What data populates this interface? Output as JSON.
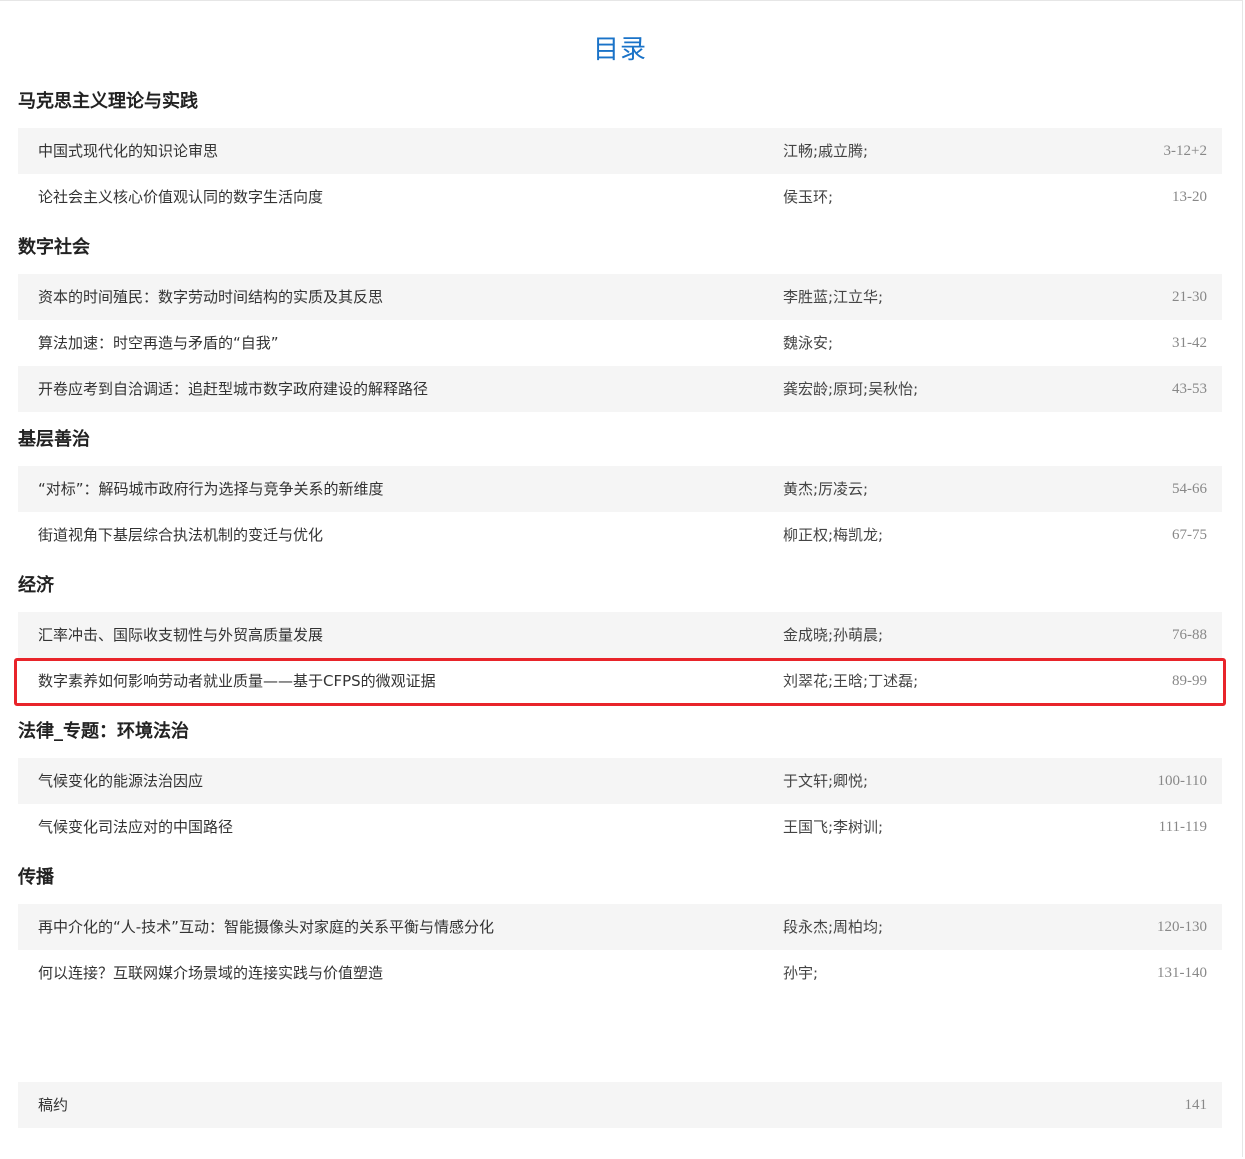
{
  "page_title": "目录",
  "sections": [
    {
      "heading": "马克思主义理论与实践",
      "items": [
        {
          "title": "中国式现代化的知识论审思",
          "authors": "江畅;戚立腾;",
          "pages": "3-12+2"
        },
        {
          "title": "论社会主义核心价值观认同的数字生活向度",
          "authors": "侯玉环;",
          "pages": "13-20"
        }
      ]
    },
    {
      "heading": "数字社会",
      "items": [
        {
          "title": "资本的时间殖民：数字劳动时间结构的实质及其反思",
          "authors": "李胜蓝;江立华;",
          "pages": "21-30"
        },
        {
          "title": "算法加速：时空再造与矛盾的“自我”",
          "authors": "魏泳安;",
          "pages": "31-42"
        },
        {
          "title": "开卷应考到自洽调适：追赶型城市数字政府建设的解释路径",
          "authors": "龚宏龄;原珂;吴秋怡;",
          "pages": "43-53"
        }
      ]
    },
    {
      "heading": "基层善治",
      "items": [
        {
          "title": "“对标”：解码城市政府行为选择与竞争关系的新维度",
          "authors": "黄杰;厉凌云;",
          "pages": "54-66"
        },
        {
          "title": "街道视角下基层综合执法机制的变迁与优化",
          "authors": "柳正权;梅凯龙;",
          "pages": "67-75"
        }
      ]
    },
    {
      "heading": "经济",
      "items": [
        {
          "title": "汇率冲击、国际收支韧性与外贸高质量发展",
          "authors": "金成晓;孙萌晨;",
          "pages": "76-88"
        },
        {
          "title": "数字素养如何影响劳动者就业质量——基于CFPS的微观证据",
          "authors": "刘翠花;王晗;丁述磊;",
          "pages": "89-99",
          "highlighted": true
        }
      ]
    },
    {
      "heading": "法律_专题：环境法治",
      "items": [
        {
          "title": "气候变化的能源法治因应",
          "authors": "于文轩;卿悦;",
          "pages": "100-110"
        },
        {
          "title": "气候变化司法应对的中国路径",
          "authors": "王国飞;李树训;",
          "pages": "111-119"
        }
      ]
    },
    {
      "heading": "传播",
      "items": [
        {
          "title": "再中介化的“人-技术”互动：智能摄像头对家庭的关系平衡与情感分化",
          "authors": "段永杰;周柏均;",
          "pages": "120-130"
        },
        {
          "title": "何以连接？互联网媒介场景域的连接实践与价值塑造",
          "authors": "孙宇;",
          "pages": "131-140"
        }
      ]
    }
  ],
  "footer_item": {
    "title": "稿约",
    "pages": "141"
  },
  "colors": {
    "title_blue": "#1a73c8",
    "highlight_red": "#e8242a",
    "row_shade": "#f5f5f5"
  }
}
